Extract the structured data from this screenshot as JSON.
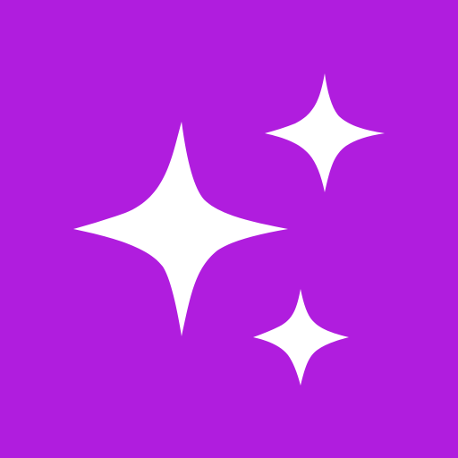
{
  "app_icon": {
    "icon_name": "sparkles-icon",
    "background_color": "#B01DDE",
    "glyph_color": "#FFFFFF",
    "sparkle_count": 3
  }
}
